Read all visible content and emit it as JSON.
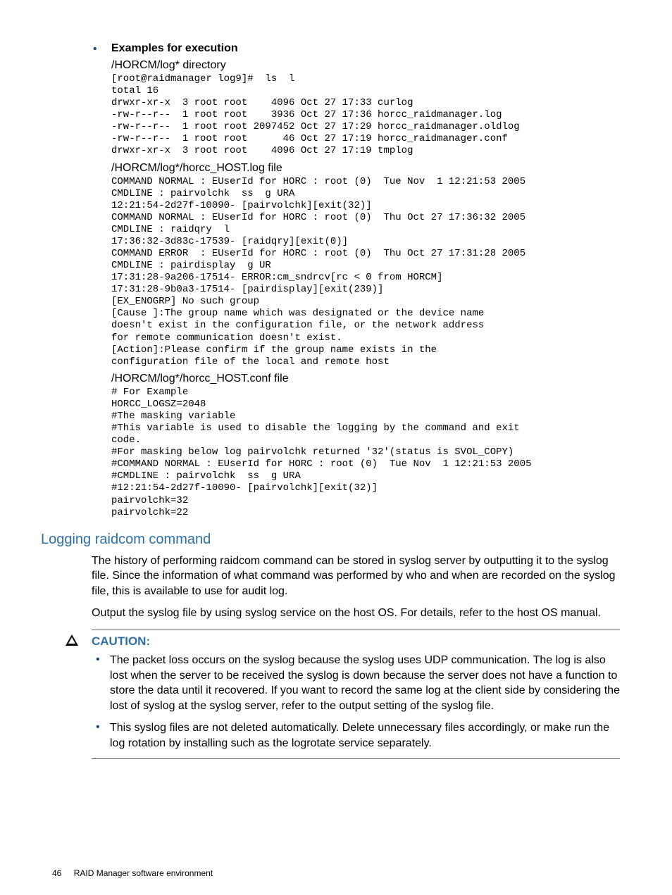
{
  "top_bullet_label": "Examples for execution",
  "dir_heading": "/HORCM/log* directory",
  "code1": "[root@raidmanager log9]#  ls  l\ntotal 16\ndrwxr-xr-x  3 root root    4096 Oct 27 17:33 curlog\n-rw-r--r--  1 root root    3936 Oct 27 17:36 horcc_raidmanager.log\n-rw-r--r--  1 root root 2097452 Oct 27 17:29 horcc_raidmanager.oldlog\n-rw-r--r--  1 root root      46 Oct 27 17:19 horcc_raidmanager.conf\ndrwxr-xr-x  3 root root    4096 Oct 27 17:19 tmplog",
  "log_heading": "/HORCM/log*/horcc_HOST.log file",
  "code2": "COMMAND NORMAL : EUserId for HORC : root (0)  Tue Nov  1 12:21:53 2005\nCMDLINE : pairvolchk  ss  g URA\n12:21:54-2d27f-10090- [pairvolchk][exit(32)]\nCOMMAND NORMAL : EUserId for HORC : root (0)  Thu Oct 27 17:36:32 2005\nCMDLINE : raidqry  l\n17:36:32-3d83c-17539- [raidqry][exit(0)]\nCOMMAND ERROR  : EUserId for HORC : root (0)  Thu Oct 27 17:31:28 2005\nCMDLINE : pairdisplay  g UR\n17:31:28-9a206-17514- ERROR:cm_sndrcv[rc < 0 from HORCM]\n17:31:28-9b0a3-17514- [pairdisplay][exit(239)]\n[EX_ENOGRP] No such group\n[Cause ]:The group name which was designated or the device name\ndoesn't exist in the configuration file, or the network address\nfor remote communication doesn't exist.\n[Action]:Please confirm if the group name exists in the\nconfiguration file of the local and remote host",
  "conf_heading": "/HORCM/log*/horcc_HOST.conf file",
  "code3": "# For Example\nHORCC_LOGSZ=2048\n#The masking variable\n#This variable is used to disable the logging by the command and exit\ncode.\n#For masking below log pairvolchk returned '32'(status is SVOL_COPY)\n#COMMAND NORMAL : EUserId for HORC : root (0)  Tue Nov  1 12:21:53 2005\n#CMDLINE : pairvolchk  ss  g URA\n#12:21:54-2d27f-10090- [pairvolchk][exit(32)]\npairvolchk=32\npairvolchk=22",
  "section_heading": "Logging raidcom command",
  "body_p1": "The history of performing raidcom command can be stored in syslog server by outputting it to the syslog file. Since the information of what command was performed by who and when are recorded on the syslog file, this is available to use for audit log.",
  "body_p2": "Output the syslog file by using syslog service on the host OS. For details, refer to the host OS manual.",
  "caution_label": "CAUTION:",
  "caution_b1": "The packet loss occurs on the syslog because the syslog uses UDP communication. The log is also lost when the server to be received the syslog is down because the server does not have a function to store the data until it recovered. If you want to record the same log at the client side by considering the lost of syslog at the syslog server, refer to the output setting of the syslog file.",
  "caution_b2": "This syslog files are not deleted automatically. Delete unnecessary files accordingly, or make run the log rotation by installing such as the logrotate service separately.",
  "footer_page": "46",
  "footer_text": "RAID Manager software environment"
}
